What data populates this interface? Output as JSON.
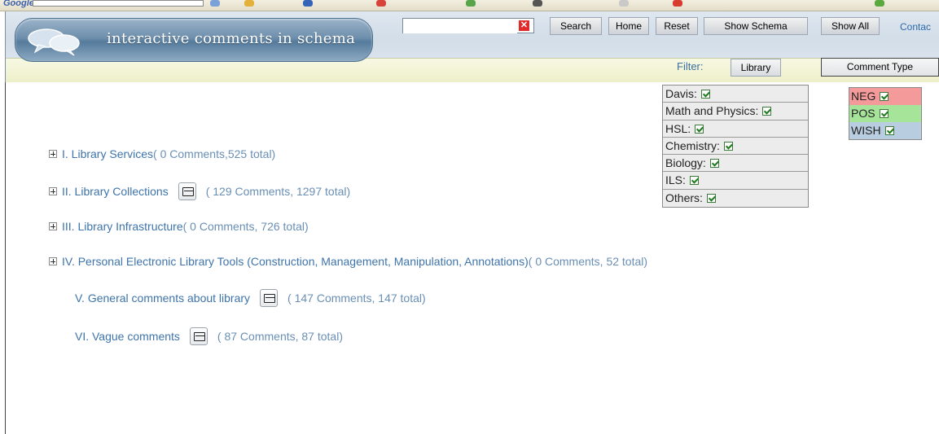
{
  "app": {
    "title": "interactive comments in schema"
  },
  "toolbar": {
    "search_value": "",
    "search_label": "Search",
    "home_label": "Home",
    "reset_label": "Reset",
    "show_schema_label": "Show Schema",
    "show_all_label": "Show All",
    "contact_label": "Contac"
  },
  "filter": {
    "label": "Filter:",
    "library_label": "Library",
    "comment_type_label": "Comment Type",
    "libraries": [
      {
        "label": "Davis:",
        "checked": true
      },
      {
        "label": "Math and Physics:",
        "checked": true
      },
      {
        "label": "HSL:",
        "checked": true
      },
      {
        "label": "Chemistry:",
        "checked": true
      },
      {
        "label": "Biology:",
        "checked": true
      },
      {
        "label": "ILS:",
        "checked": true
      },
      {
        "label": "Others:",
        "checked": true
      }
    ],
    "comment_types": [
      {
        "label": "NEG",
        "checked": true,
        "color": "#f49a9a"
      },
      {
        "label": "POS",
        "checked": true,
        "color": "#a6e49a"
      },
      {
        "label": "WISH",
        "checked": true,
        "color": "#b9cde0"
      }
    ]
  },
  "tree": [
    {
      "label": "I. Library Services",
      "count": "( 0 Comments,525 total)",
      "expandable": true,
      "has_comment_icon": false
    },
    {
      "label": "II. Library Collections",
      "count": "( 129 Comments, 1297 total)",
      "expandable": true,
      "has_comment_icon": true
    },
    {
      "label": "III. Library Infrastructure",
      "count": "( 0 Comments, 726 total)",
      "expandable": true,
      "has_comment_icon": false
    },
    {
      "label": "IV. Personal Electronic Library Tools (Construction, Management, Manipulation, Annotations)",
      "count": "( 0 Comments, 52 total)",
      "expandable": true,
      "has_comment_icon": false
    },
    {
      "label": "V. General comments about library",
      "count": "( 147 Comments, 147 total)",
      "expandable": false,
      "has_comment_icon": true
    },
    {
      "label": "VI. Vague comments",
      "count": "( 87 Comments, 87 total)",
      "expandable": false,
      "has_comment_icon": true
    }
  ]
}
